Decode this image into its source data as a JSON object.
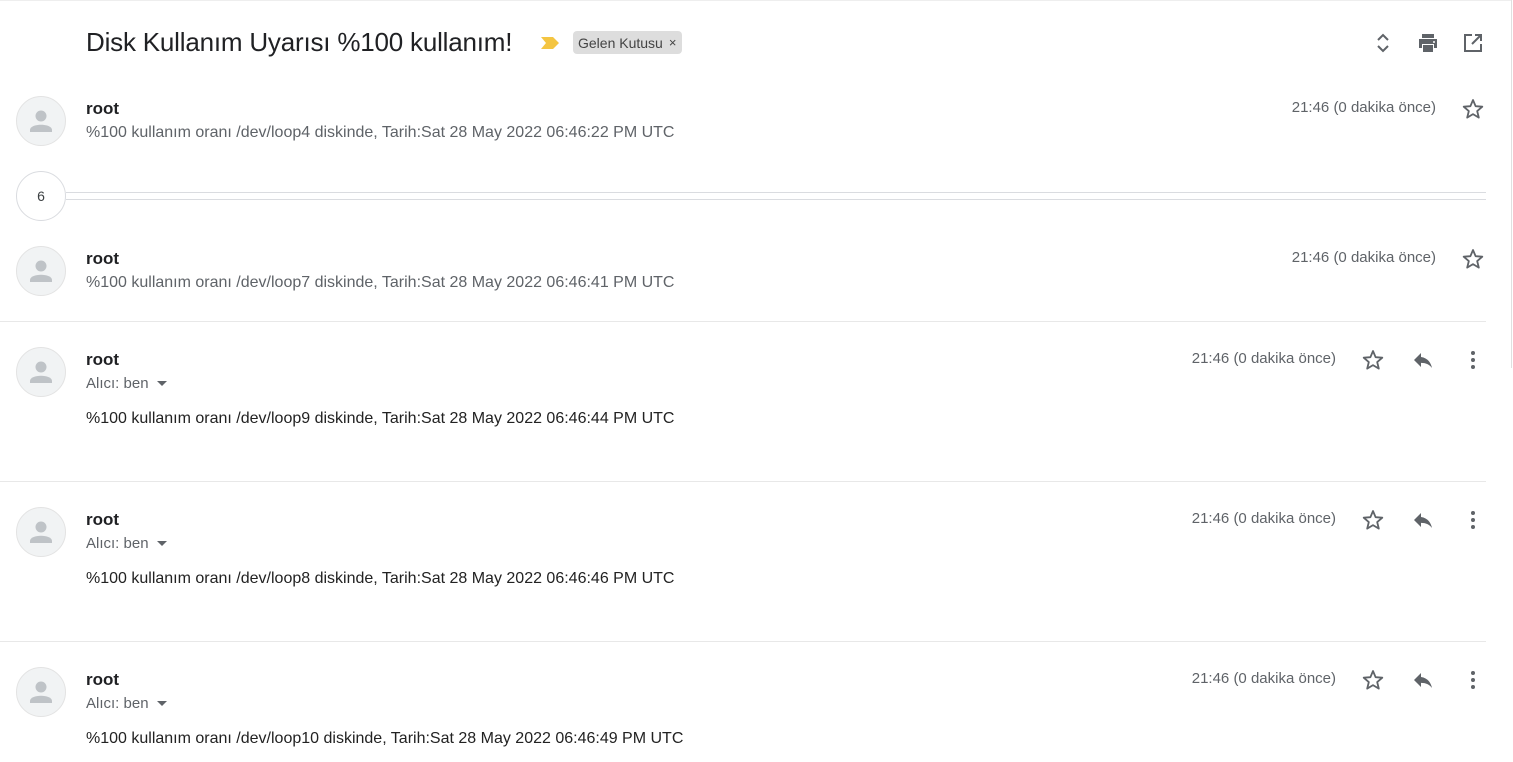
{
  "thread": {
    "subject": "Disk Kullanım Uyarısı %100 kullanım!",
    "label": "Gelen Kutusu",
    "label_remove": "×",
    "importance_color": "#f4c542",
    "icons": [
      "expand-collapse-icon",
      "print-icon",
      "open-in-new-window-icon"
    ]
  },
  "collapsed_count": "6",
  "messages": [
    {
      "sender": "root",
      "time": "21:46 (0 dakika önce)",
      "snippet": "%100 kullanım oranı /dev/loop4 diskinde, Tarih:Sat 28 May 2022 06:46:22 PM UTC"
    },
    {
      "sender": "root",
      "time": "21:46 (0 dakika önce)",
      "snippet": "%100 kullanım oranı /dev/loop7 diskinde, Tarih:Sat 28 May 2022 06:46:41 PM UTC"
    },
    {
      "sender": "root",
      "time": "21:46 (0 dakika önce)",
      "recipient": "Alıcı: ben",
      "body": "%100 kullanım oranı /dev/loop9 diskinde, Tarih:Sat 28 May 2022 06:46:44 PM UTC"
    },
    {
      "sender": "root",
      "time": "21:46 (0 dakika önce)",
      "recipient": "Alıcı: ben",
      "body": "%100 kullanım oranı /dev/loop8 diskinde, Tarih:Sat 28 May 2022 06:46:46 PM UTC"
    },
    {
      "sender": "root",
      "time": "21:46 (0 dakika önce)",
      "recipient": "Alıcı: ben",
      "body": "%100 kullanım oranı /dev/loop10 diskinde, Tarih:Sat 28 May 2022 06:46:49 PM UTC"
    }
  ]
}
